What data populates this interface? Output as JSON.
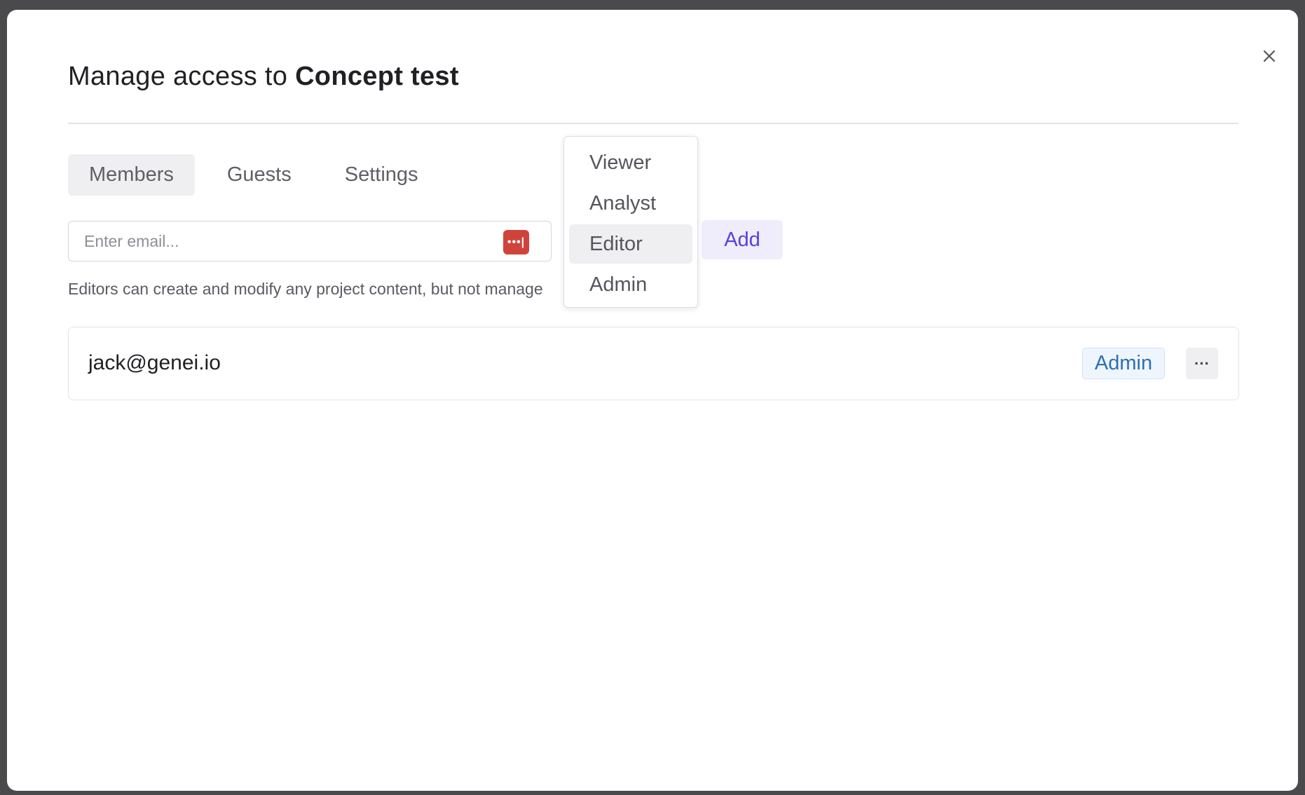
{
  "dialog": {
    "title_prefix": "Manage access to",
    "title_project": "Concept test",
    "close_icon": "close-icon"
  },
  "tabs": [
    {
      "label": "Members",
      "active": true
    },
    {
      "label": "Guests",
      "active": false
    },
    {
      "label": "Settings",
      "active": false
    }
  ],
  "invite": {
    "email_value": "",
    "email_placeholder": "Enter email...",
    "password_manager_icon": "password-manager-icon",
    "password_manager_glyph": "•••|",
    "add_label": "Add"
  },
  "role_dropdown": {
    "options": [
      "Viewer",
      "Analyst",
      "Editor",
      "Admin"
    ],
    "selected": "Editor"
  },
  "helper_text": "Editors can create and modify any project content, but not manage",
  "members": [
    {
      "email": "jack@genei.io",
      "role": "Admin",
      "more_glyph": "···"
    }
  ],
  "colors": {
    "accent": "#5b3fd8",
    "role_badge": "#2f6fb5",
    "password_manager": "#d0433b"
  }
}
